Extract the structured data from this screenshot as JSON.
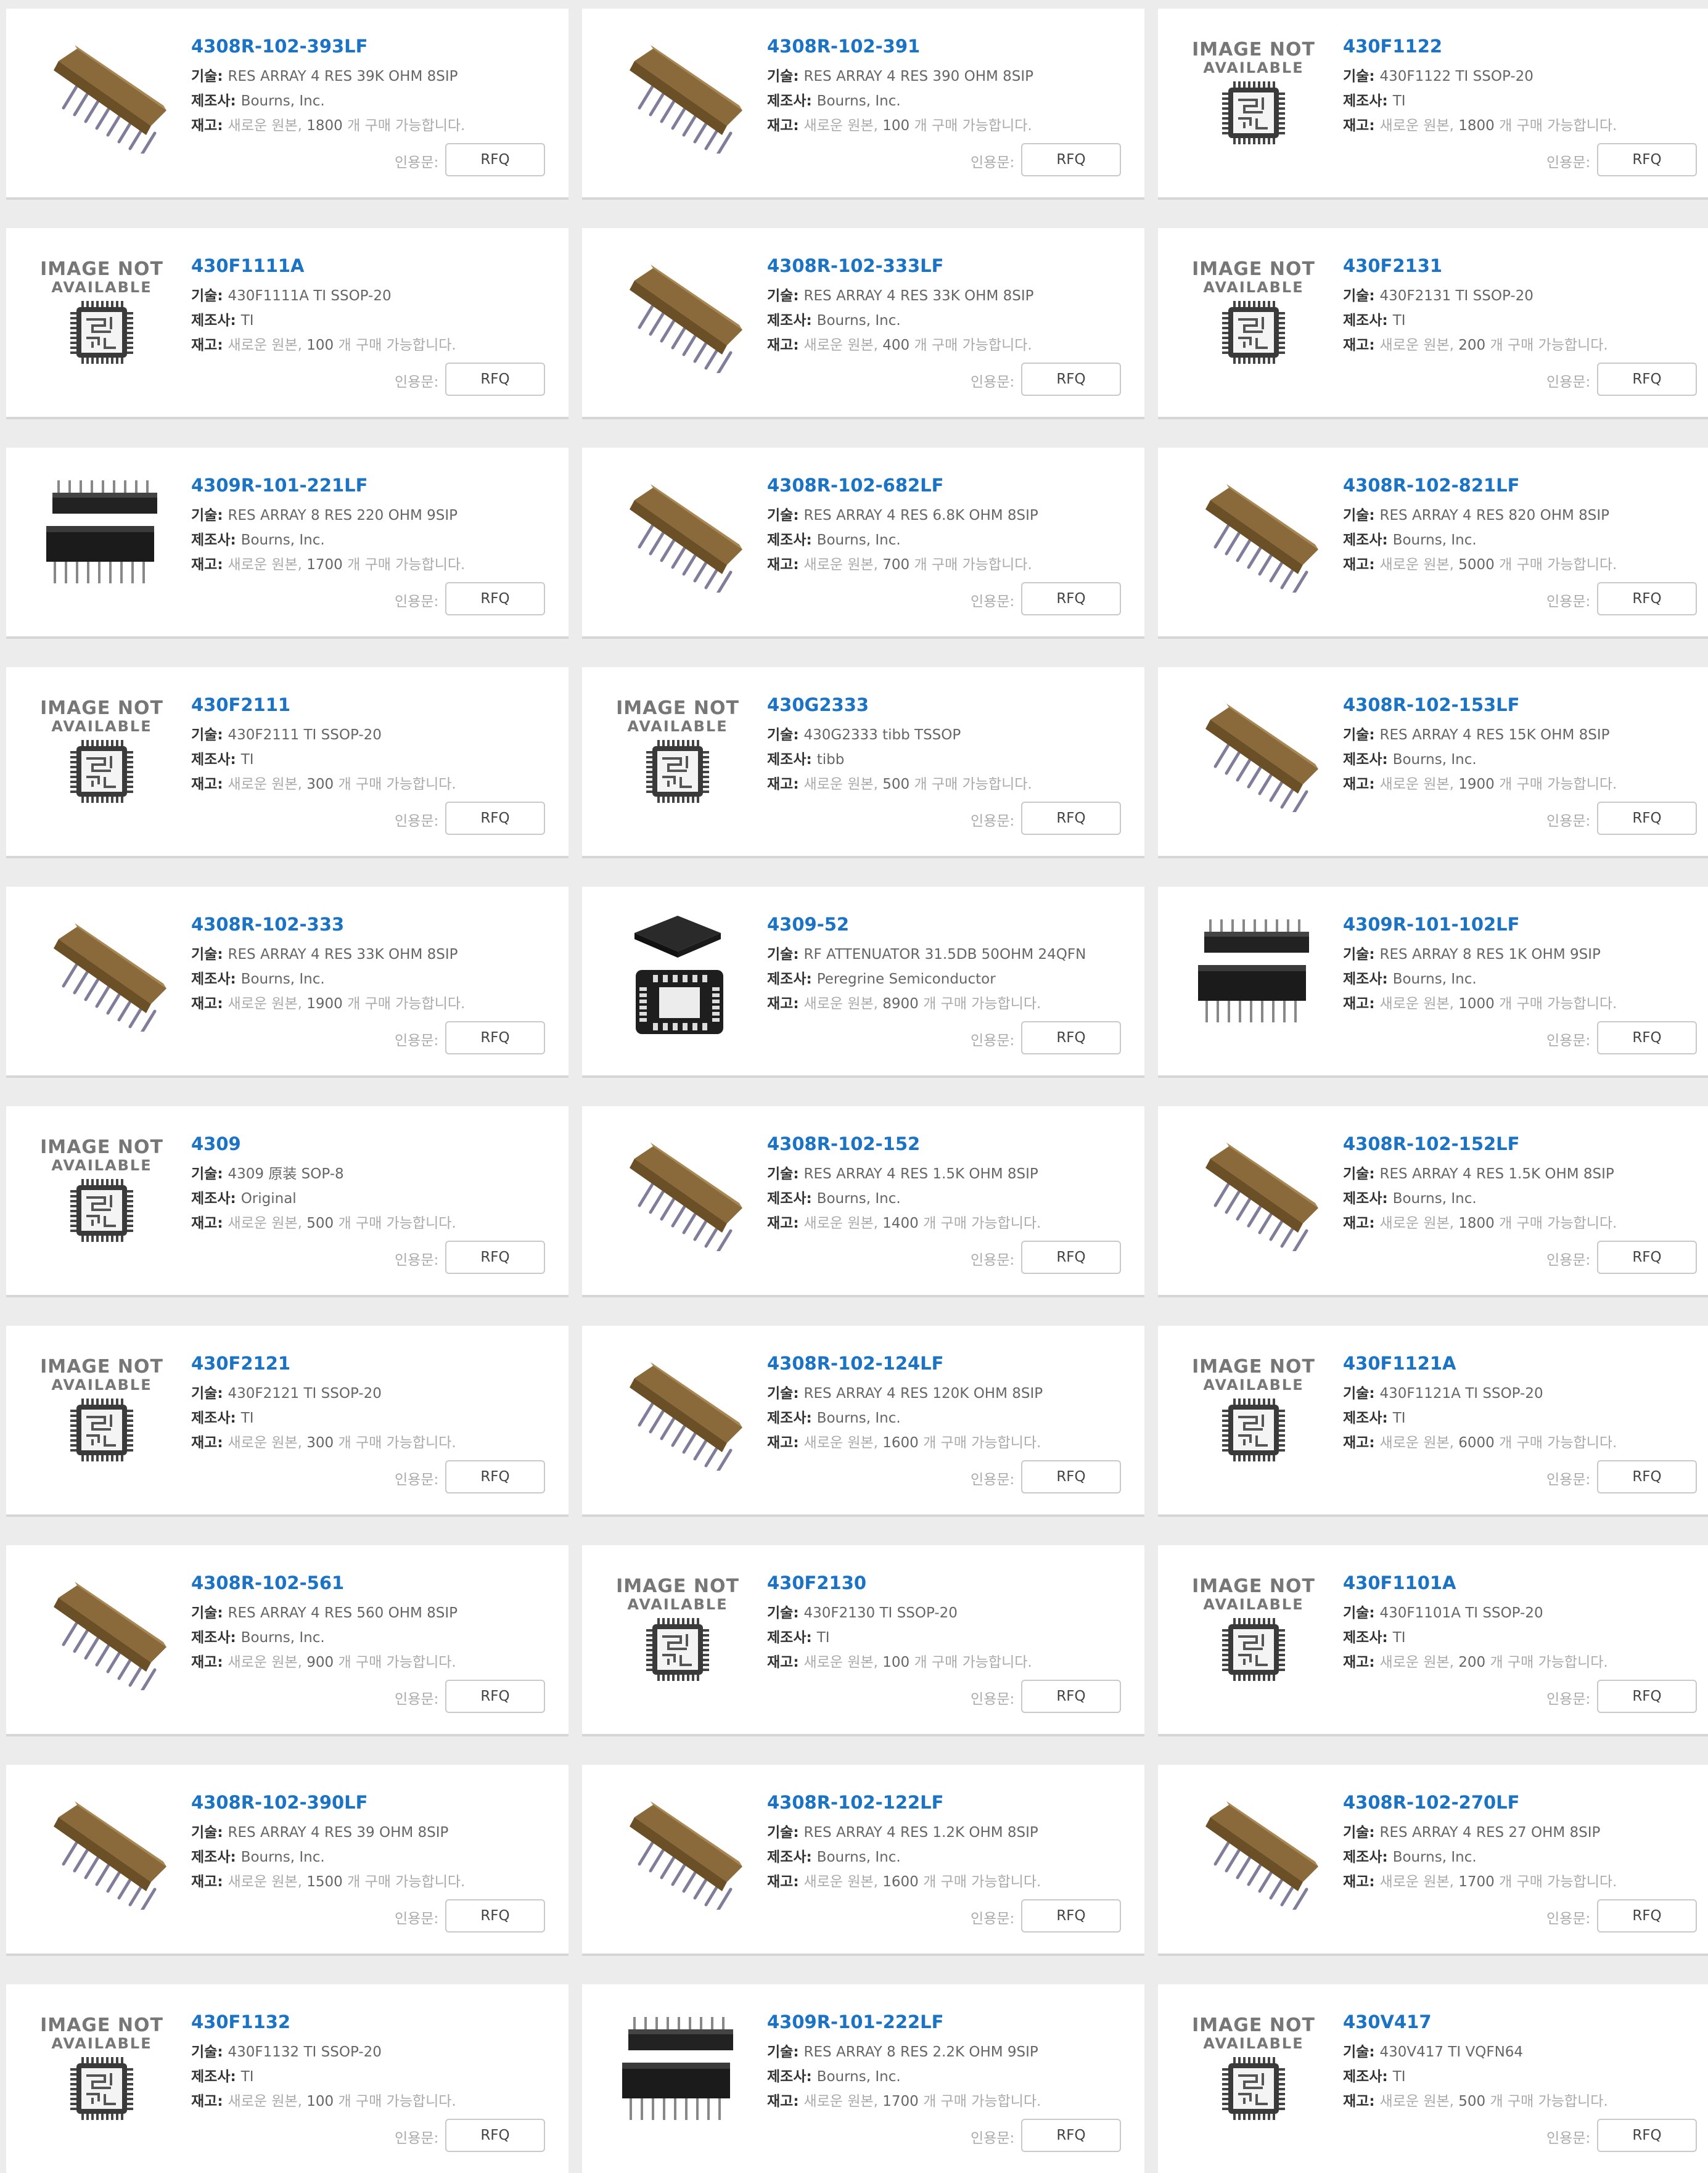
{
  "labels": {
    "desc": "기술:",
    "maker": "제조사:",
    "stock": "재고:",
    "stock_prefix": "새로운 원본, ",
    "stock_suffix": " 개 구매 가능합니다.",
    "quote": "인용문:",
    "rfq": "RFQ",
    "image_not_available_1": "IMAGE NOT",
    "image_not_available_2": "AVAILABLE"
  },
  "products": [
    {
      "part": "4308R-102-393LF",
      "desc": "RES ARRAY 4 RES 39K OHM 8SIP",
      "maker": "Bourns, Inc.",
      "qty": "1800",
      "icon": "sip-resistor-icon"
    },
    {
      "part": "4308R-102-391",
      "desc": "RES ARRAY 4 RES 390 OHM 8SIP",
      "maker": "Bourns, Inc.",
      "qty": "100",
      "icon": "sip-resistor-icon"
    },
    {
      "part": "430F1122",
      "desc": "430F1122 TI SSOP-20",
      "maker": "TI",
      "qty": "1800",
      "icon": "image-not-available-icon"
    },
    {
      "part": "430F1111A",
      "desc": "430F1111A TI SSOP-20",
      "maker": "TI",
      "qty": "100",
      "icon": "image-not-available-icon"
    },
    {
      "part": "4308R-102-333LF",
      "desc": "RES ARRAY 4 RES 33K OHM 8SIP",
      "maker": "Bourns, Inc.",
      "qty": "400",
      "icon": "sip-resistor-icon"
    },
    {
      "part": "430F2131",
      "desc": "430F2131 TI SSOP-20",
      "maker": "TI",
      "qty": "200",
      "icon": "image-not-available-icon"
    },
    {
      "part": "4309R-101-221LF",
      "desc": "RES ARRAY 8 RES 220 OHM 9SIP",
      "maker": "Bourns, Inc.",
      "qty": "1700",
      "icon": "black-sip-icon"
    },
    {
      "part": "4308R-102-682LF",
      "desc": "RES ARRAY 4 RES 6.8K OHM 8SIP",
      "maker": "Bourns, Inc.",
      "qty": "700",
      "icon": "sip-resistor-icon"
    },
    {
      "part": "4308R-102-821LF",
      "desc": "RES ARRAY 4 RES 820 OHM 8SIP",
      "maker": "Bourns, Inc.",
      "qty": "5000",
      "icon": "sip-resistor-icon"
    },
    {
      "part": "430F2111",
      "desc": "430F2111 TI SSOP-20",
      "maker": "TI",
      "qty": "300",
      "icon": "image-not-available-icon"
    },
    {
      "part": "430G2333",
      "desc": "430G2333 tibb TSSOP",
      "maker": "tibb",
      "qty": "500",
      "icon": "image-not-available-icon"
    },
    {
      "part": "4308R-102-153LF",
      "desc": "RES ARRAY 4 RES 15K OHM 8SIP",
      "maker": "Bourns, Inc.",
      "qty": "1900",
      "icon": "sip-resistor-icon"
    },
    {
      "part": "4308R-102-333",
      "desc": "RES ARRAY 4 RES 33K OHM 8SIP",
      "maker": "Bourns, Inc.",
      "qty": "1900",
      "icon": "sip-resistor-icon"
    },
    {
      "part": "4309-52",
      "desc": "RF ATTENUATOR 31.5DB 50OHM 24QFN",
      "maker": "Peregrine Semiconductor",
      "qty": "8900",
      "icon": "qfn-chip-icon"
    },
    {
      "part": "4309R-101-102LF",
      "desc": "RES ARRAY 8 RES 1K OHM 9SIP",
      "maker": "Bourns, Inc.",
      "qty": "1000",
      "icon": "black-sip-icon"
    },
    {
      "part": "4309",
      "desc": "4309 原装 SOP-8",
      "maker": "Original",
      "qty": "500",
      "icon": "image-not-available-icon"
    },
    {
      "part": "4308R-102-152",
      "desc": "RES ARRAY 4 RES 1.5K OHM 8SIP",
      "maker": "Bourns, Inc.",
      "qty": "1400",
      "icon": "sip-resistor-icon"
    },
    {
      "part": "4308R-102-152LF",
      "desc": "RES ARRAY 4 RES 1.5K OHM 8SIP",
      "maker": "Bourns, Inc.",
      "qty": "1800",
      "icon": "sip-resistor-icon"
    },
    {
      "part": "430F2121",
      "desc": "430F2121 TI SSOP-20",
      "maker": "TI",
      "qty": "300",
      "icon": "image-not-available-icon"
    },
    {
      "part": "4308R-102-124LF",
      "desc": "RES ARRAY 4 RES 120K OHM 8SIP",
      "maker": "Bourns, Inc.",
      "qty": "1600",
      "icon": "sip-resistor-icon"
    },
    {
      "part": "430F1121A",
      "desc": "430F1121A TI SSOP-20",
      "maker": "TI",
      "qty": "6000",
      "icon": "image-not-available-icon"
    },
    {
      "part": "4308R-102-561",
      "desc": "RES ARRAY 4 RES 560 OHM 8SIP",
      "maker": "Bourns, Inc.",
      "qty": "900",
      "icon": "sip-resistor-icon"
    },
    {
      "part": "430F2130",
      "desc": "430F2130 TI SSOP-20",
      "maker": "TI",
      "qty": "100",
      "icon": "image-not-available-icon"
    },
    {
      "part": "430F1101A",
      "desc": "430F1101A TI SSOP-20",
      "maker": "TI",
      "qty": "200",
      "icon": "image-not-available-icon"
    },
    {
      "part": "4308R-102-390LF",
      "desc": "RES ARRAY 4 RES 39 OHM 8SIP",
      "maker": "Bourns, Inc.",
      "qty": "1500",
      "icon": "sip-resistor-icon"
    },
    {
      "part": "4308R-102-122LF",
      "desc": "RES ARRAY 4 RES 1.2K OHM 8SIP",
      "maker": "Bourns, Inc.",
      "qty": "1600",
      "icon": "sip-resistor-icon"
    },
    {
      "part": "4308R-102-270LF",
      "desc": "RES ARRAY 4 RES 27 OHM 8SIP",
      "maker": "Bourns, Inc.",
      "qty": "1700",
      "icon": "sip-resistor-icon"
    },
    {
      "part": "430F1132",
      "desc": "430F1132 TI SSOP-20",
      "maker": "TI",
      "qty": "100",
      "icon": "image-not-available-icon"
    },
    {
      "part": "4309R-101-222LF",
      "desc": "RES ARRAY 8 RES 2.2K OHM 9SIP",
      "maker": "Bourns, Inc.",
      "qty": "1700",
      "icon": "black-sip-icon"
    },
    {
      "part": "430V417",
      "desc": "430V417 TI VQFN64",
      "maker": "TI",
      "qty": "500",
      "icon": "image-not-available-icon"
    }
  ]
}
